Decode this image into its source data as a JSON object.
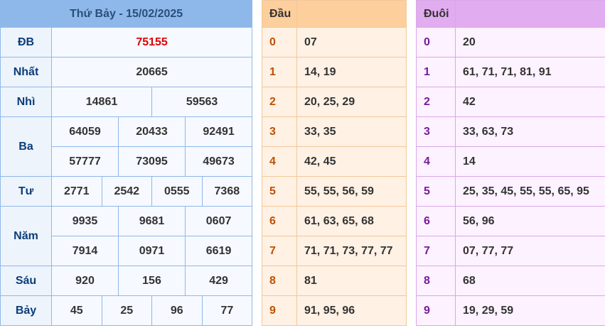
{
  "title": "Thứ Bảy - 15/02/2025",
  "prizes": {
    "db": {
      "label": "ĐB",
      "values": [
        "75155"
      ]
    },
    "nhat": {
      "label": "Nhất",
      "values": [
        "20665"
      ]
    },
    "nhi": {
      "label": "Nhì",
      "values": [
        "14861",
        "59563"
      ]
    },
    "ba": {
      "label": "Ba",
      "values": [
        "64059",
        "20433",
        "92491",
        "57777",
        "73095",
        "49673"
      ]
    },
    "tu": {
      "label": "Tư",
      "values": [
        "2771",
        "2542",
        "0555",
        "7368"
      ]
    },
    "nam": {
      "label": "Năm",
      "values": [
        "9935",
        "9681",
        "0607",
        "7914",
        "0971",
        "6619"
      ]
    },
    "sau": {
      "label": "Sáu",
      "values": [
        "920",
        "156",
        "429"
      ]
    },
    "bay": {
      "label": "Bảy",
      "values": [
        "45",
        "25",
        "96",
        "77"
      ]
    }
  },
  "dau": {
    "header": "Đầu",
    "rows": [
      {
        "digit": "0",
        "values": "07"
      },
      {
        "digit": "1",
        "values": "14, 19"
      },
      {
        "digit": "2",
        "values": "20, 25, 29"
      },
      {
        "digit": "3",
        "values": "33, 35"
      },
      {
        "digit": "4",
        "values": "42, 45"
      },
      {
        "digit": "5",
        "values": "55, 55, 56, 59"
      },
      {
        "digit": "6",
        "values": "61, 63, 65, 68"
      },
      {
        "digit": "7",
        "values": "71, 71, 73, 77, 77"
      },
      {
        "digit": "8",
        "values": "81"
      },
      {
        "digit": "9",
        "values": "91, 95, 96"
      }
    ]
  },
  "duoi": {
    "header": "Đuôi",
    "rows": [
      {
        "digit": "0",
        "values": "20"
      },
      {
        "digit": "1",
        "values": "61, 71, 71, 81, 91"
      },
      {
        "digit": "2",
        "values": "42"
      },
      {
        "digit": "3",
        "values": "33, 63, 73"
      },
      {
        "digit": "4",
        "values": "14"
      },
      {
        "digit": "5",
        "values": "25, 35, 45, 55, 55, 65, 95"
      },
      {
        "digit": "6",
        "values": "56, 96"
      },
      {
        "digit": "7",
        "values": "07, 77, 77"
      },
      {
        "digit": "8",
        "values": "68"
      },
      {
        "digit": "9",
        "values": "19, 29, 59"
      }
    ]
  }
}
